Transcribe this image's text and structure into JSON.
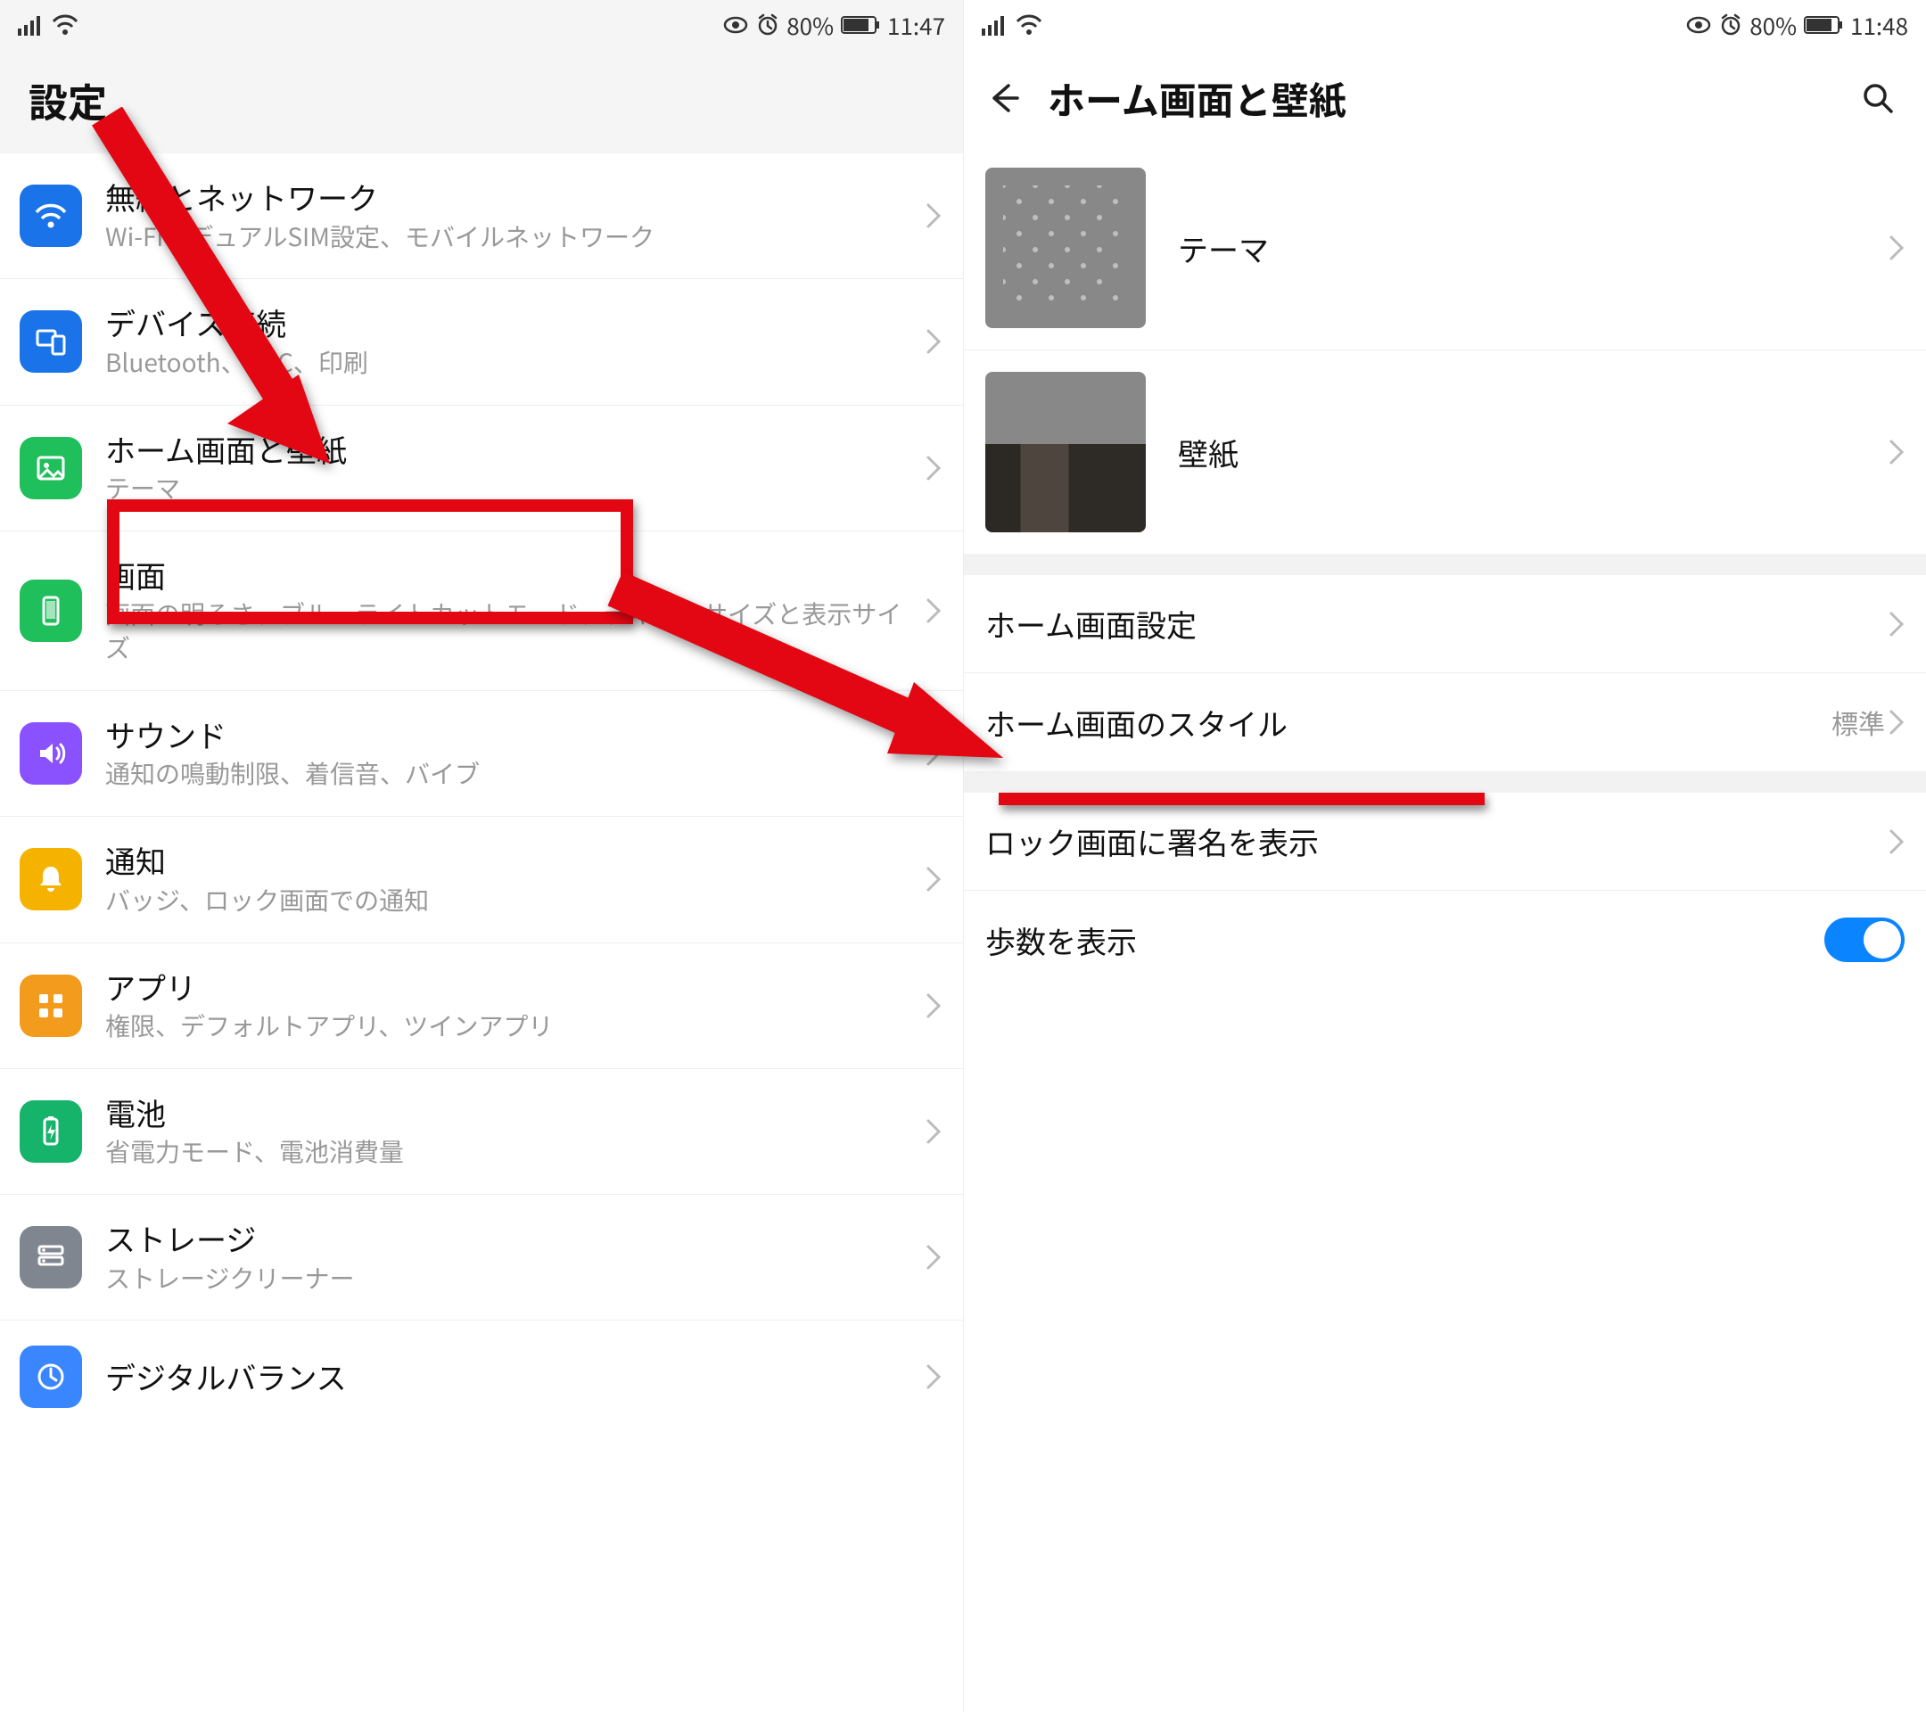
{
  "screen1": {
    "status": {
      "battery_pct": "80%",
      "time": "11:47"
    },
    "title": "設定",
    "items": [
      {
        "title": "無線とネットワーク",
        "subtitle": "Wi-Fi、デュアルSIM設定、モバイルネットワーク",
        "icon": "wifi",
        "color": "#1a73e8"
      },
      {
        "title": "デバイス接続",
        "subtitle": "Bluetooth、NFC、印刷",
        "icon": "devices",
        "color": "#1a73e8"
      },
      {
        "title": "ホーム画面と壁紙",
        "subtitle": "テーマ",
        "icon": "image",
        "color": "#1fbf5c"
      },
      {
        "title": "画面",
        "subtitle": "画面の明るさ、ブルーライトカットモード、テキストサイズと表示サイズ",
        "icon": "display",
        "color": "#1fbf5c"
      },
      {
        "title": "サウンド",
        "subtitle": "通知の鳴動制限、着信音、バイブ",
        "icon": "sound",
        "color": "#8a52ff"
      },
      {
        "title": "通知",
        "subtitle": "バッジ、ロック画面での通知",
        "icon": "bell",
        "color": "#f5b300"
      },
      {
        "title": "アプリ",
        "subtitle": "権限、デフォルトアプリ、ツインアプリ",
        "icon": "apps",
        "color": "#f29b1d"
      },
      {
        "title": "電池",
        "subtitle": "省電力モード、電池消費量",
        "icon": "battery",
        "color": "#16b36b"
      },
      {
        "title": "ストレージ",
        "subtitle": "ストレージクリーナー",
        "icon": "storage",
        "color": "#7f8690"
      },
      {
        "title": "デジタルバランス",
        "subtitle": "",
        "icon": "balance",
        "color": "#3a86ff"
      }
    ]
  },
  "screen2": {
    "status": {
      "battery_pct": "80%",
      "time": "11:48"
    },
    "title": "ホーム画面と壁紙",
    "media": [
      {
        "label": "テーマ",
        "thumb": "theme"
      },
      {
        "label": "壁紙",
        "thumb": "wallpaper"
      }
    ],
    "rows": [
      {
        "label": "ホーム画面設定",
        "value": "",
        "kind": "chevron"
      },
      {
        "label": "ホーム画面のスタイル",
        "value": "標準",
        "kind": "chevron"
      }
    ],
    "rows2": [
      {
        "label": "ロック画面に署名を表示",
        "value": "",
        "kind": "chevron"
      },
      {
        "label": "歩数を表示",
        "value": "",
        "kind": "toggle",
        "on": true
      }
    ]
  }
}
